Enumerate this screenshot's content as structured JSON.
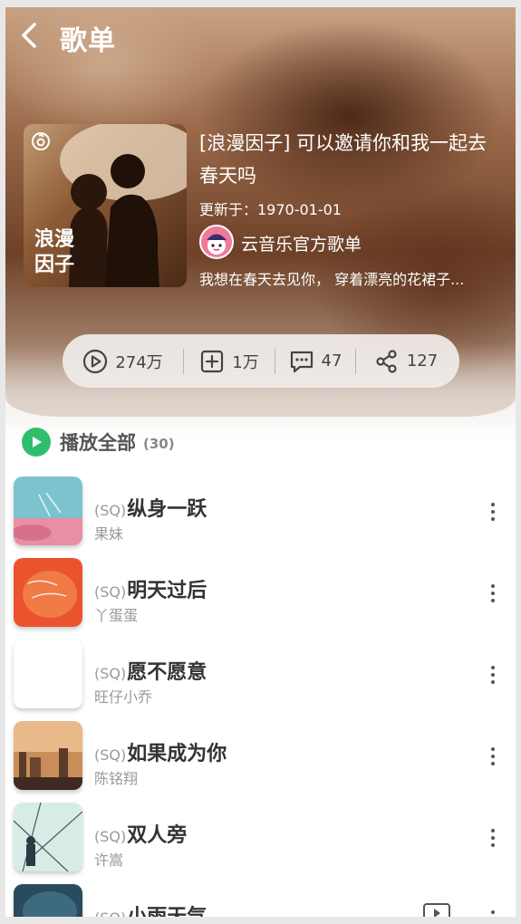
{
  "header": {
    "title": "歌单"
  },
  "playlist": {
    "cover_text": "浪漫\n因子",
    "cover_text_1": "浪漫",
    "cover_text_2": "因子",
    "name": "[浪漫因子] 可以邀请你和我一起去春天吗",
    "updated": "更新于：1970-01-01",
    "owner": "云音乐官方歌单",
    "description": "我想在春天去见你， 穿着漂亮的花裙子..."
  },
  "stats": {
    "plays": "274万",
    "favorites": "1万",
    "comments": "47",
    "shares": "127"
  },
  "play_all": {
    "label": "播放全部",
    "count": "(30)"
  },
  "songs": [
    {
      "tag": "(SQ)",
      "title": "纵身一跃",
      "artist": "果妹"
    },
    {
      "tag": "(SQ)",
      "title": "明天过后",
      "artist": "丫蛋蛋"
    },
    {
      "tag": "(SQ)",
      "title": "愿不愿意",
      "artist": "旺仔小乔"
    },
    {
      "tag": "(SQ)",
      "title": "如果成为你",
      "artist": "陈铭翔"
    },
    {
      "tag": "(SQ)",
      "title": "双人旁",
      "artist": "许嵩"
    },
    {
      "tag": "(SQ)",
      "title": "小雨天气",
      "artist": ""
    }
  ],
  "colors": {
    "play_green": "#2fbf6c",
    "title_text": "#333333",
    "meta_text": "#999999"
  }
}
